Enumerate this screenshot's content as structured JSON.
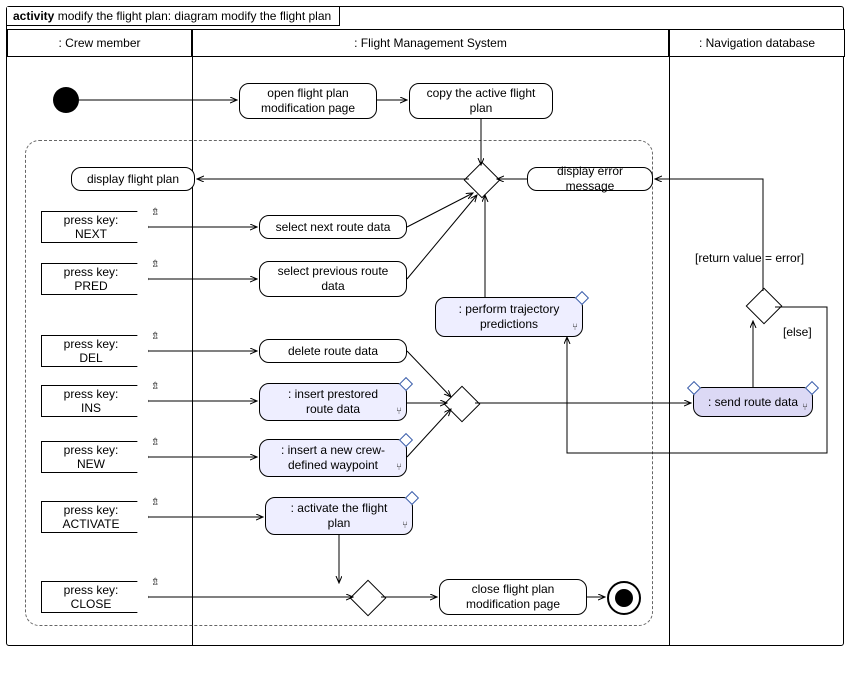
{
  "frame": {
    "keyword": "activity",
    "title": "modify the flight plan: diagram modify the flight plan"
  },
  "lanes": {
    "crew": ": Crew member",
    "fms": ": Flight Management System",
    "nav": ": Navigation database"
  },
  "nodes": {
    "open_page": "open flight plan\nmodification page",
    "copy_plan": "copy the active flight\nplan",
    "display_plan": "display flight plan",
    "select_next": "select next route data",
    "select_prev": "select previous route\ndata",
    "perform_pred": ": perform trajectory\npredictions",
    "delete_route": "delete route data",
    "insert_prestored": ": insert prestored\nroute data",
    "insert_crew_wp": ": insert a new crew-\ndefined waypoint",
    "activate_plan": ": activate the flight\nplan",
    "close_page": "close flight plan\nmodification page",
    "display_error": "display error message",
    "send_route": ": send route data"
  },
  "signals": {
    "next": "press key:\nNEXT",
    "pred": "press key:\nPRED",
    "del": "press key:\nDEL",
    "ins": "press key:\nINS",
    "new": "press key:\nNEW",
    "activate": "press key:\nACTIVATE",
    "close": "press key:\nCLOSE"
  },
  "guards": {
    "err": "[return value = error]",
    "else": "[else]"
  }
}
